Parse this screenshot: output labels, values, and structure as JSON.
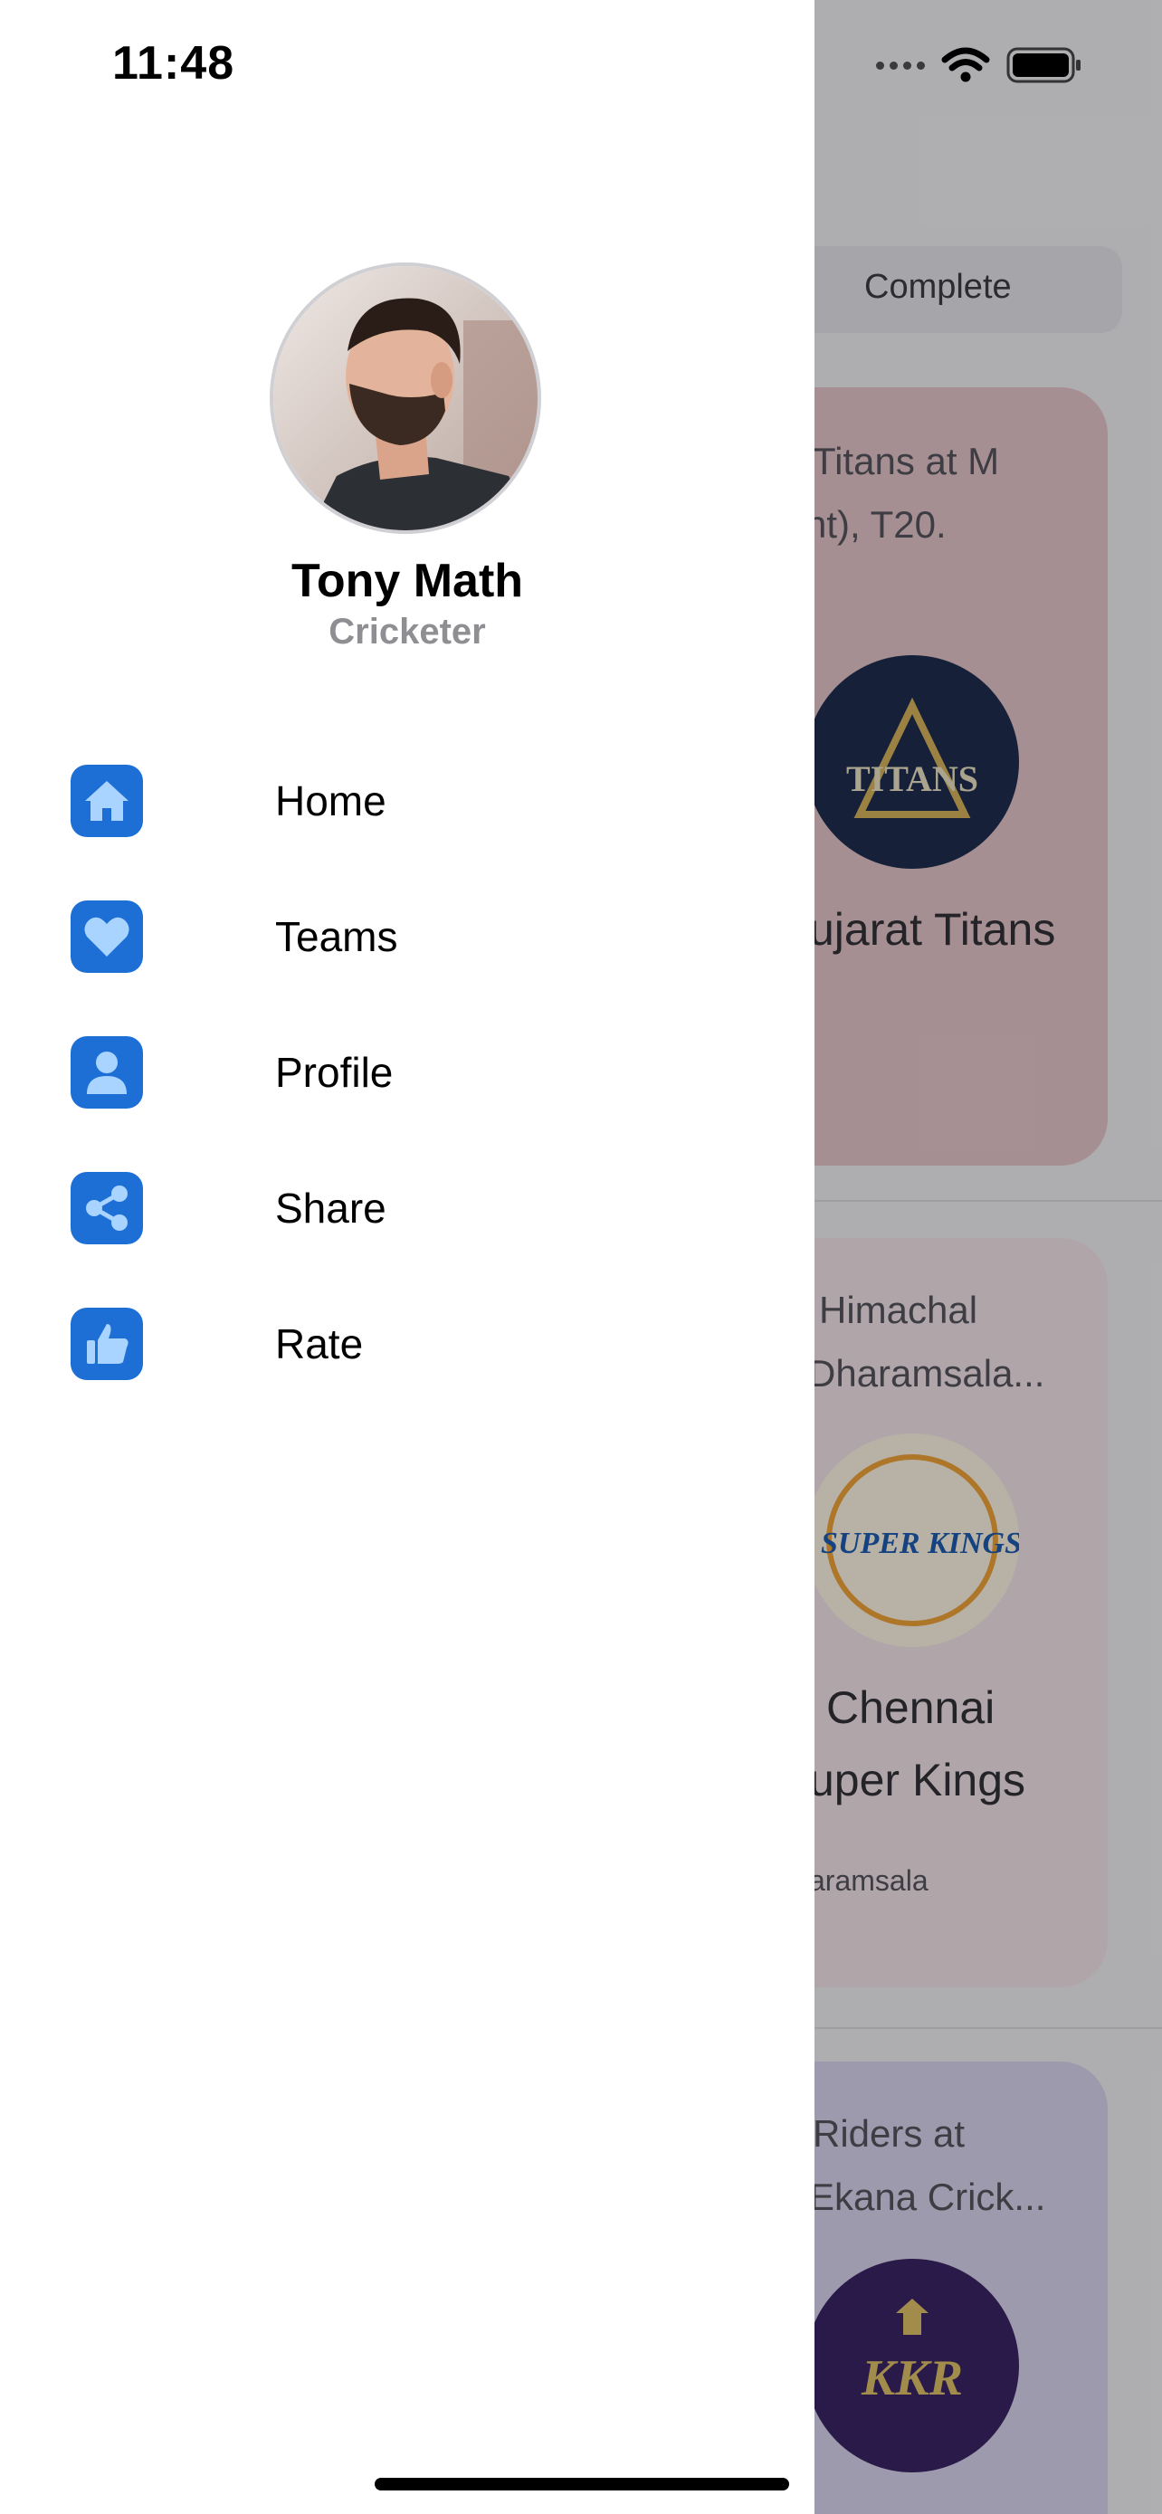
{
  "status_bar": {
    "time": "11:48"
  },
  "background": {
    "segment_label": "Complete",
    "cards": [
      {
        "lines": [
          "Titans at M",
          "ht), T20."
        ],
        "team": [
          "ujarat Titans"
        ],
        "logo": "TITANS",
        "venue": ""
      },
      {
        "lines": [
          "Himachal",
          "Dharamsala..."
        ],
        "team": [
          "Chennai",
          "uper Kings"
        ],
        "logo": "SUPER KINGS",
        "venue": "aramsala"
      },
      {
        "lines": [
          "Riders at",
          "Ekana Crick..."
        ],
        "team": [],
        "logo": "KKR",
        "venue": ""
      }
    ]
  },
  "drawer": {
    "profile": {
      "name": "Tony Math",
      "role": "Cricketer"
    },
    "menu": [
      {
        "label": "Home",
        "icon": "home-icon"
      },
      {
        "label": "Teams",
        "icon": "heart-icon"
      },
      {
        "label": "Profile",
        "icon": "person-icon"
      },
      {
        "label": "Share",
        "icon": "share-icon"
      },
      {
        "label": "Rate",
        "icon": "thumbs-up-icon"
      }
    ]
  },
  "colors": {
    "accent": "#1d6fd6",
    "icon_fill": "#a9d4ff",
    "drawer_bg": "#ffffff"
  }
}
